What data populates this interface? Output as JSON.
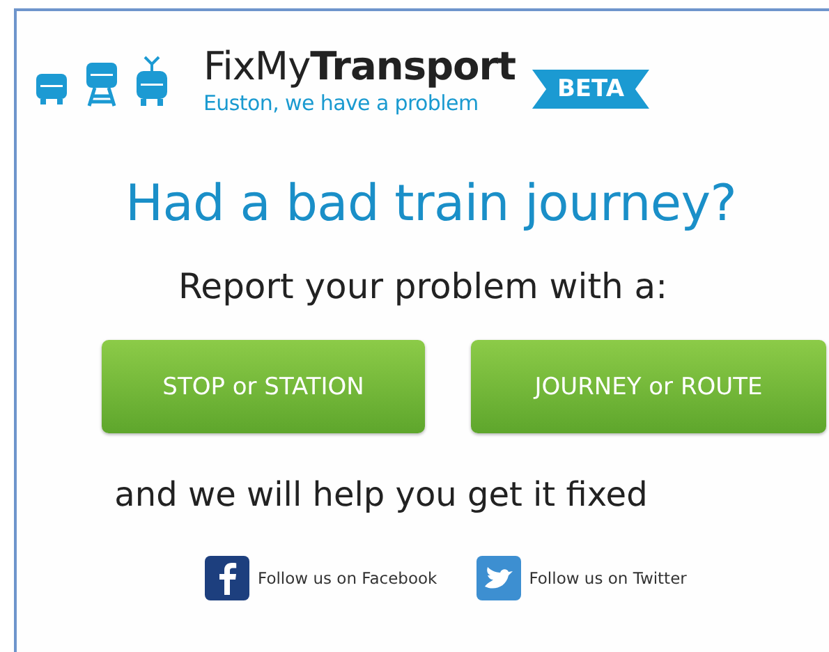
{
  "logo": {
    "name_light": "FixMy",
    "name_bold": "Transport",
    "tagline": "Euston, we have a problem",
    "badge": "BETA"
  },
  "heading": "Had a bad train journey?",
  "intro": "Report your problem with a:",
  "buttons": [
    "STOP or STATION",
    "JOURNEY or ROUTE"
  ],
  "outro": "and we will help you get it fixed",
  "social": [
    {
      "kind": "facebook",
      "label": "Follow us on Facebook"
    },
    {
      "kind": "twitter",
      "label": "Follow us on Twitter"
    }
  ]
}
